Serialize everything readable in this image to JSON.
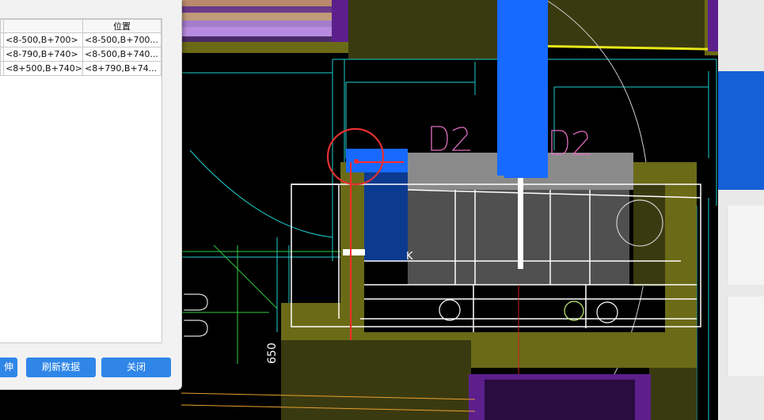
{
  "panel": {
    "table": {
      "header": [
        "",
        "",
        "位置"
      ],
      "rows": [
        [
          "",
          "<8-500,B+700>",
          "<8-500,B+700..."
        ],
        [
          "",
          "<8-790,B+740>",
          "<8-500,B+740..."
        ],
        [
          "",
          "<8+500,B+740>",
          "<8+790,B+74..."
        ]
      ]
    },
    "buttons": {
      "left_partial": "伸",
      "refresh": "刷新数据",
      "close": "关闭"
    }
  },
  "cad": {
    "dimension_text": "650",
    "label_k": "K"
  },
  "colors": {
    "olive": "#6b6a17",
    "blue": "#1769ff",
    "navy": "#0b3a8f",
    "gray": "#8a8a8a",
    "dark_gray": "#505050",
    "purple": "#5c1f8c",
    "cyan": "#1ecfcf",
    "accent_button": "#2f86e8",
    "highlight_circle": "#e53030"
  }
}
